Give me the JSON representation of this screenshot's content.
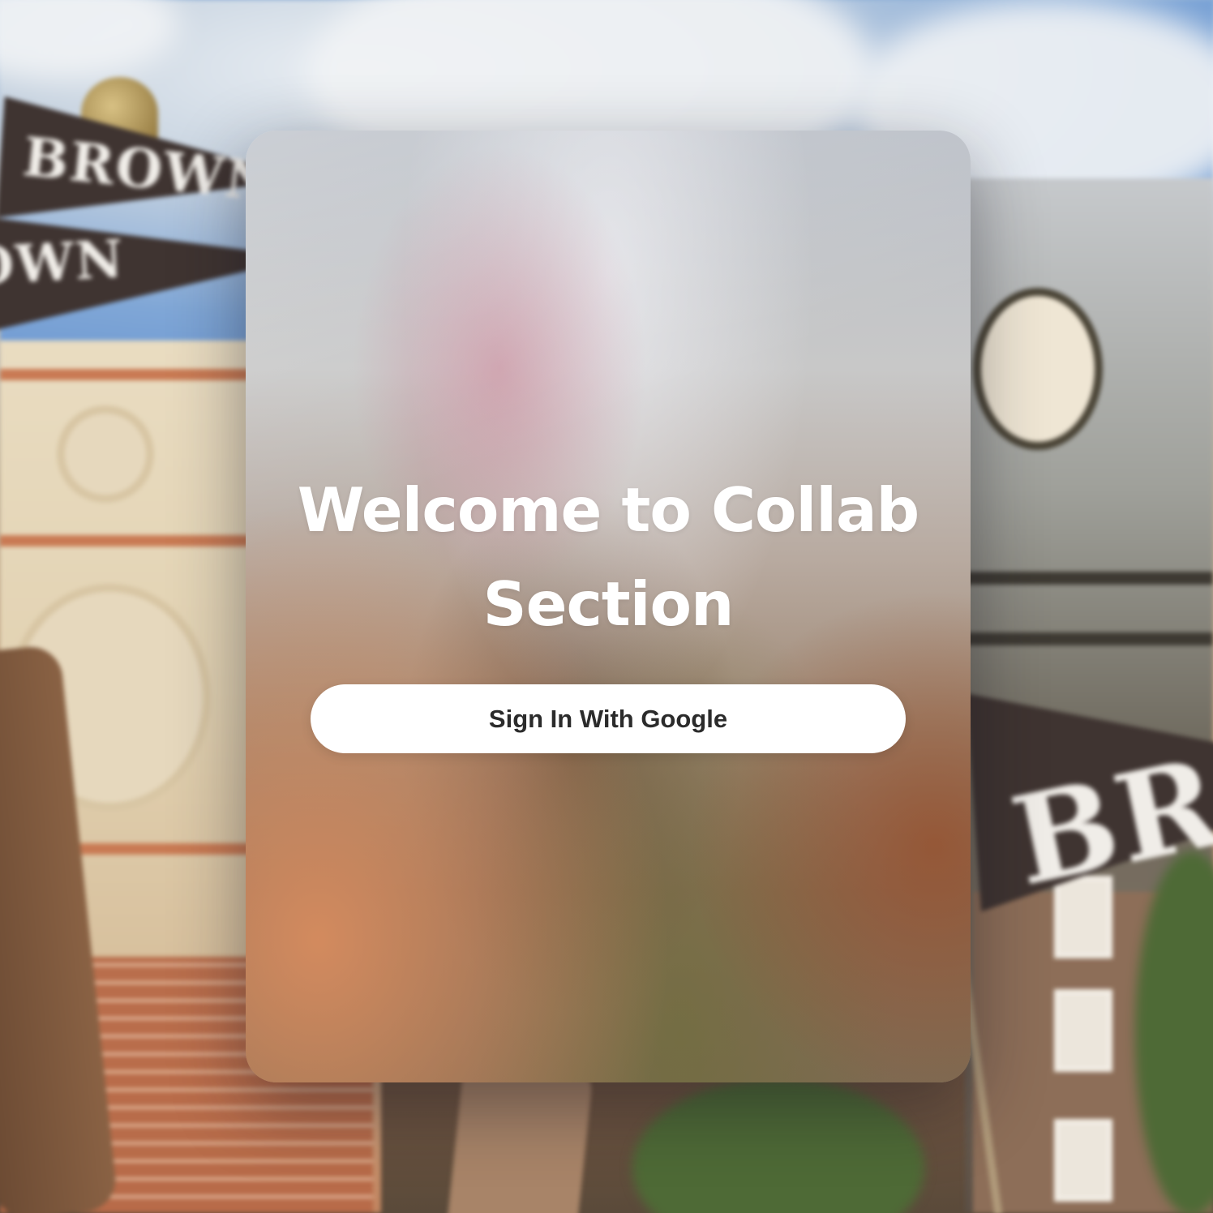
{
  "background": {
    "pennant_text": "BROWN"
  },
  "login_card": {
    "title": "Welcome to Collab Section",
    "sign_in_button": "Sign In With Google"
  },
  "colors": {
    "button_background": "#ffffff",
    "button_text": "#2b2b2b",
    "title_text": "#ffffff",
    "pennant_brown": "#3f3431"
  }
}
